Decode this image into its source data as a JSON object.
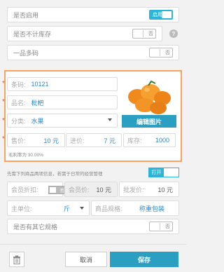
{
  "toggles": {
    "enable": {
      "label": "是否启用",
      "state": "启用"
    },
    "no_stock": {
      "label": "是否不计库存",
      "state": "否"
    },
    "one_product_multi_code": {
      "label": "一品多码",
      "state": "否"
    }
  },
  "product": {
    "barcode": {
      "label": "条码:",
      "value": "10121"
    },
    "name": {
      "label": "品名:",
      "value": "枇杷"
    },
    "category": {
      "label": "分类:",
      "value": "水果"
    },
    "sale_price": {
      "label": "售价:",
      "value": "10 元"
    },
    "purchase_price": {
      "label": "进价:",
      "value": "7 元"
    },
    "stock": {
      "label": "库存:",
      "value": "1000"
    },
    "profit_rate": "毛利率为 30.00%",
    "edit_image": "编辑图片"
  },
  "member": {
    "hint": "先需下列商品两项信息，若需于日常的经营管理",
    "open_label": "打开",
    "discount_label": "会员折扣:",
    "discount_toggle": "否",
    "member_price_label": "会员价:",
    "member_price_value": "10 元",
    "wholesale_label": "批发价:",
    "wholesale_value": "10 元"
  },
  "unit": {
    "label": "主单位:",
    "value": "斤",
    "spec_label": "商品规格:",
    "spec_value": "称重包装"
  },
  "other_spec": {
    "label": "是否有其它规格",
    "state": "否"
  },
  "footer": {
    "cancel": "取消",
    "save": "保存"
  },
  "colors": {
    "accent": "#2bb5d8",
    "highlight_border": "#f7a35c",
    "save": "#2b9fc2"
  },
  "icons": [
    "help-icon",
    "trash-icon",
    "chevron-down-icon",
    "fruit-photo"
  ]
}
